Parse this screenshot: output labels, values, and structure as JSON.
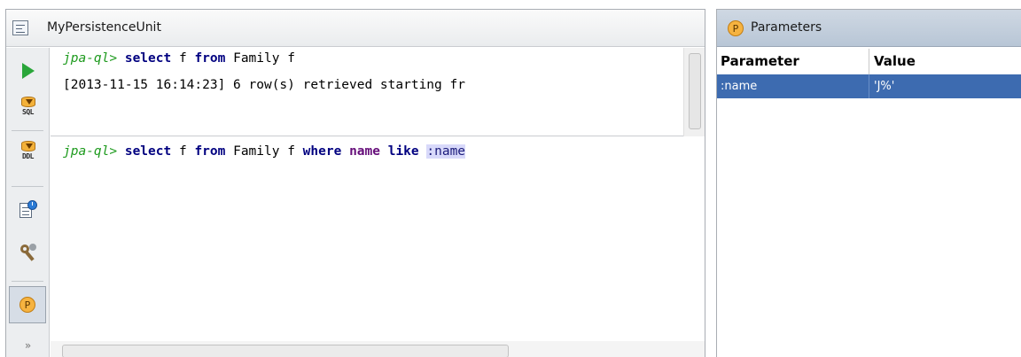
{
  "console": {
    "title": "MyPersistenceUnit",
    "output": {
      "prompt": "jpa-ql>",
      "query_keyword_select": "select",
      "query_f": "f",
      "query_keyword_from": "from",
      "query_entity": "Family f",
      "log": "[2013-11-15 16:14:23] 6 row(s) retrieved starting fr"
    },
    "input": {
      "prompt": "jpa-ql>",
      "kw_select": "select",
      "f": "f",
      "kw_from": "from",
      "entity": "Family f",
      "kw_where": "where",
      "column": "name",
      "kw_like": "like",
      "param": ":name"
    },
    "toolbar": {
      "sql_label": "SQL",
      "ddl_label": "DDL",
      "params_badge": "P",
      "more": "»"
    }
  },
  "parameters": {
    "title": "Parameters",
    "badge": "P",
    "columns": [
      "Parameter",
      "Value"
    ],
    "rows": [
      {
        "parameter": ":name",
        "value": "'J%'"
      }
    ]
  },
  "colors": {
    "prompt": "#1d9a1d",
    "keyword": "#000080",
    "column": "#660e7a",
    "param_highlight": "#d8d9fa",
    "selection": "#3d6bb0",
    "run": "#2aa63a"
  }
}
